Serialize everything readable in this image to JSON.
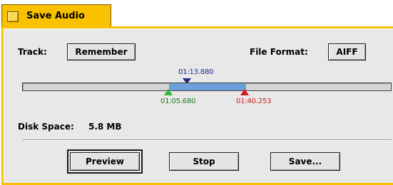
{
  "window": {
    "tab_title": "Save Audio"
  },
  "track": {
    "label": "Track:",
    "value": "Remember"
  },
  "file_format": {
    "label": "File Format:",
    "value": "AIFF"
  },
  "timeline": {
    "playhead_time": "01:13.880",
    "start_time": "01:05.680",
    "end_time": "01:40.253",
    "colors": {
      "playhead": "#1a2a8a",
      "start": "#2fb335",
      "end": "#d61a1a",
      "selection": "#6f9edc"
    }
  },
  "disk_space": {
    "label": "Disk Space:",
    "value": "5.8 MB"
  },
  "buttons": {
    "preview": "Preview",
    "stop": "Stop",
    "save": "Save..."
  },
  "accent_color": "#f9c100"
}
